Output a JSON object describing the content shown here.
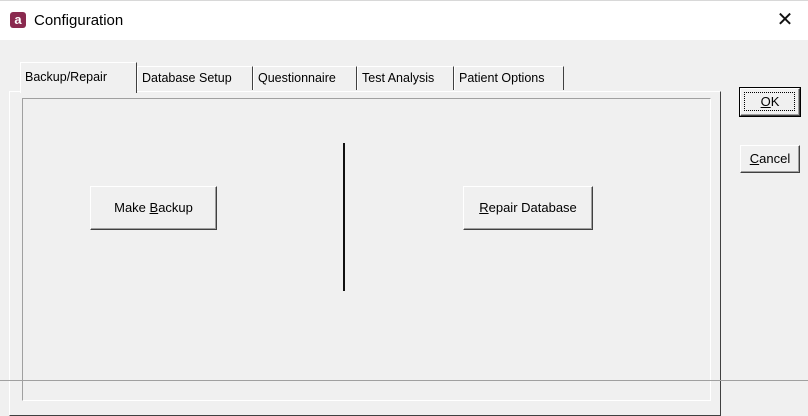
{
  "window": {
    "title": "Configuration",
    "app_icon_letter": "a",
    "close_glyph": "✕",
    "accent_color": "#8a2a4f"
  },
  "tabs": [
    {
      "label": "Backup/Repair",
      "active": true
    },
    {
      "label": "Database Setup",
      "active": false
    },
    {
      "label": "Questionnaire",
      "active": false
    },
    {
      "label": "Test Analysis",
      "active": false
    },
    {
      "label": "Patient Options",
      "active": false
    }
  ],
  "panel": {
    "make_backup": {
      "pre": "Make ",
      "mnemonic": "B",
      "post": "ackup"
    },
    "repair_database": {
      "pre": "",
      "mnemonic": "R",
      "post": "epair Database"
    }
  },
  "actions": {
    "ok": {
      "pre": "",
      "mnemonic": "O",
      "post": "K"
    },
    "cancel": {
      "pre": "",
      "mnemonic": "C",
      "post": "ancel"
    }
  }
}
